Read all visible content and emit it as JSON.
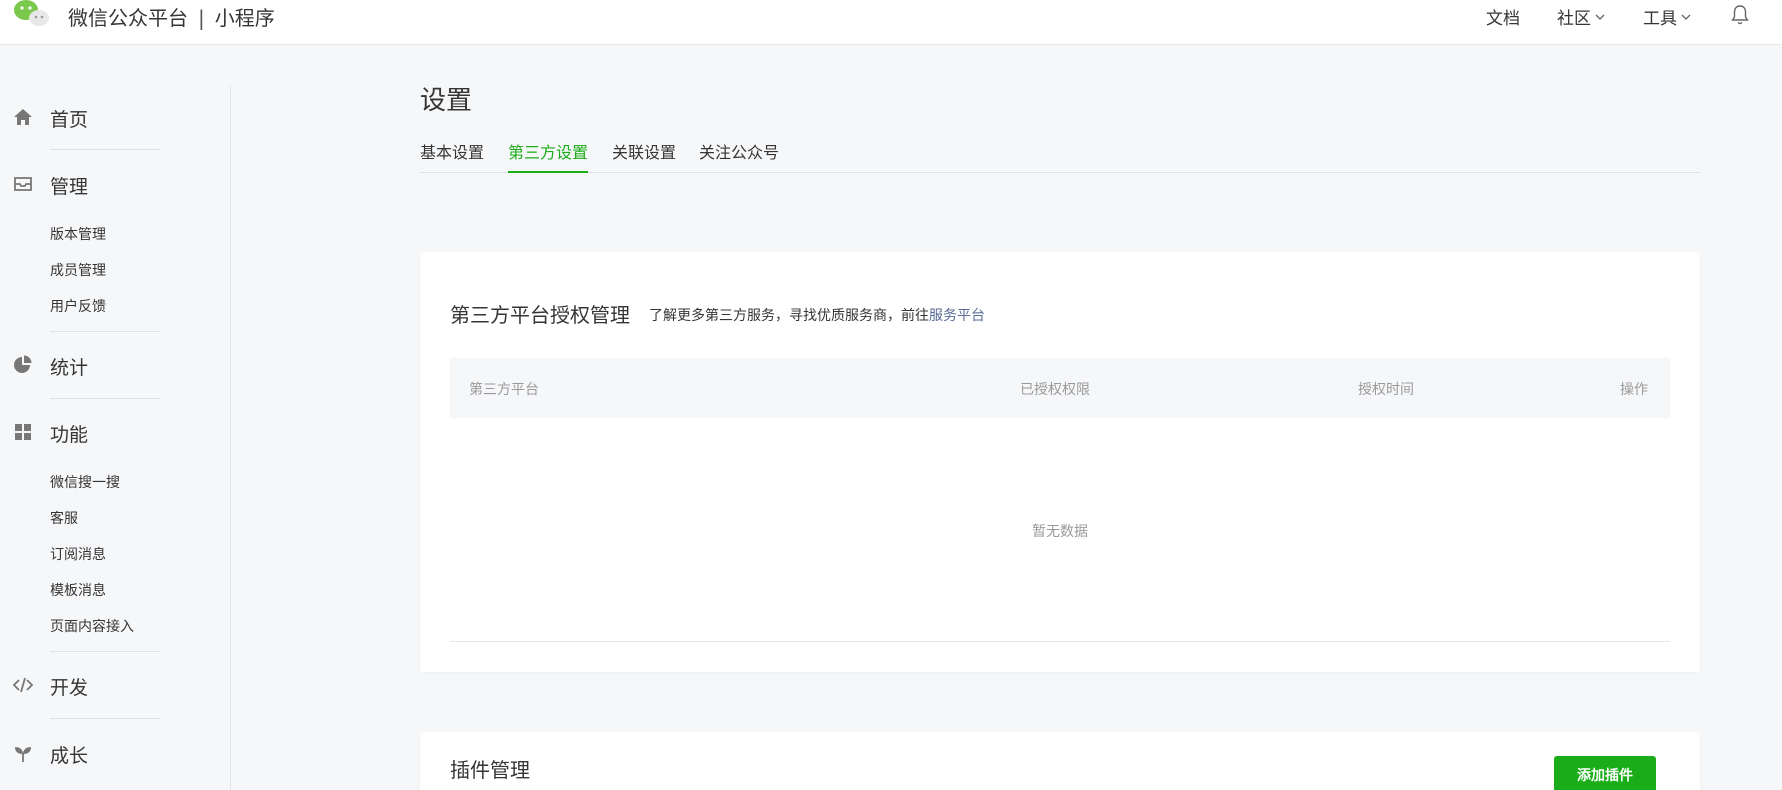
{
  "header": {
    "brand_name": "微信公众平台",
    "separator": "|",
    "product_name": "小程序",
    "nav": {
      "docs": "文档",
      "community": "社区",
      "tools": "工具"
    },
    "icons": {
      "logo": "wechat-logo-icon",
      "bell": "bell-icon",
      "chevron": "chevron-down-icon"
    }
  },
  "sidebar": {
    "home": "首页",
    "manage": "管理",
    "manage_items": [
      "版本管理",
      "成员管理",
      "用户反馈"
    ],
    "stats": "统计",
    "features": "功能",
    "features_items": [
      "微信搜一搜",
      "客服",
      "订阅消息",
      "模板消息",
      "页面内容接入"
    ],
    "develop": "开发",
    "growth": "成长"
  },
  "main": {
    "title": "设置",
    "tabs": [
      "基本设置",
      "第三方设置",
      "关联设置",
      "关注公众号"
    ],
    "active_tab": "第三方设置",
    "third_party": {
      "title": "第三方平台授权管理",
      "desc_prefix": "了解更多第三方服务，寻找优质服务商，前往",
      "desc_link": "服务平台",
      "columns": [
        "第三方平台",
        "已授权权限",
        "授权时间",
        "操作"
      ],
      "empty_text": "暂无数据"
    },
    "plugins": {
      "title": "插件管理",
      "add_button": "添加插件"
    }
  },
  "colors": {
    "accent_green": "#1aad19",
    "link_blue": "#576b95",
    "page_bg": "#f6f7f9"
  }
}
